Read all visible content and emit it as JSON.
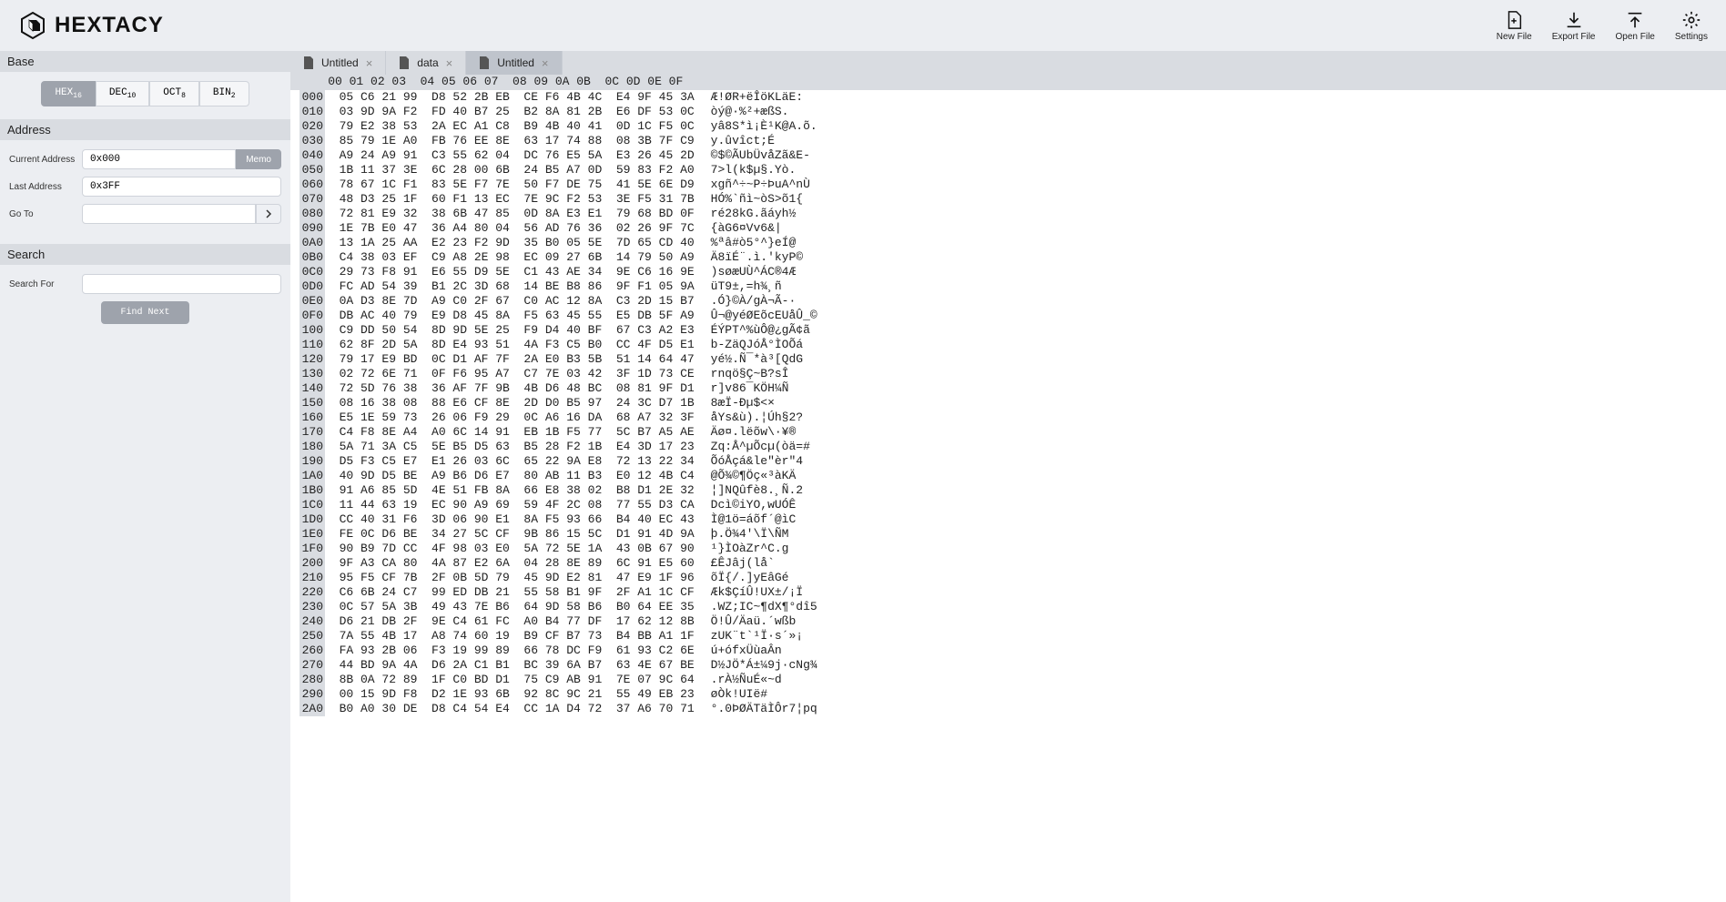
{
  "app": {
    "name": "HEXTACY"
  },
  "toolbar": {
    "new_file": "New File",
    "export_file": "Export File",
    "open_file": "Open File",
    "settings": "Settings"
  },
  "sidebar": {
    "base": {
      "title": "Base",
      "options": [
        {
          "label": "HEX",
          "sub": "16",
          "active": true
        },
        {
          "label": "DEC",
          "sub": "10",
          "active": false
        },
        {
          "label": "OCT",
          "sub": "8",
          "active": false
        },
        {
          "label": "BIN",
          "sub": "2",
          "active": false
        }
      ]
    },
    "address": {
      "title": "Address",
      "current_label": "Current Address",
      "current_value": "0x000",
      "memo_label": "Memo",
      "last_label": "Last Address",
      "last_value": "0x3FF",
      "goto_label": "Go To",
      "goto_value": ""
    },
    "search": {
      "title": "Search",
      "for_label": "Search For",
      "for_value": "",
      "find_label": "Find Next"
    }
  },
  "tabs": [
    {
      "title": "Untitled",
      "active": false
    },
    {
      "title": "data",
      "active": false
    },
    {
      "title": "Untitled",
      "active": true
    }
  ],
  "hex": {
    "col_header": "    00 01 02 03  04 05 06 07  08 09 0A 0B  0C 0D 0E 0F",
    "rows": [
      {
        "off": "000",
        "g": [
          "05 C6 21 99",
          "D8 52 2B EB",
          "CE F6 4B 4C",
          "E4 9F 45 3A"
        ],
        "a": "Æ!ØR+ëÎöKLäE:"
      },
      {
        "off": "010",
        "g": [
          "03 9D 9A F2",
          "FD 40 B7 25",
          "B2 8A 81 2B",
          "E6 DF 53 0C"
        ],
        "a": "òý@·%²+æßS."
      },
      {
        "off": "020",
        "g": [
          "79 E2 38 53",
          "2A EC A1 C8",
          "B9 4B 40 41",
          "0D 1C F5 0C"
        ],
        "a": "yâ8S*ì¡È¹K@A.õ."
      },
      {
        "off": "030",
        "g": [
          "85 79 1E A0",
          "FB 76 EE 8E",
          "63 17 74 88",
          "08 3B 7F C9"
        ],
        "a": "y.ûvîct;É"
      },
      {
        "off": "040",
        "g": [
          "A9 24 A9 91",
          "C3 55 62 04",
          "DC 76 E5 5A",
          "E3 26 45 2D"
        ],
        "a": "©$©ÃUbÜvåZã&E-"
      },
      {
        "off": "050",
        "g": [
          "1B 11 37 3E",
          "6C 28 00 6B",
          "24 B5 A7 0D",
          "59 83 F2 A0"
        ],
        "a": "7>l(k$µ§.Yò."
      },
      {
        "off": "060",
        "g": [
          "78 67 1C F1",
          "83 5E F7 7E",
          "50 F7 DE 75",
          "41 5E 6E D9"
        ],
        "a": "xgñ^÷~P÷ÞuA^nÙ"
      },
      {
        "off": "070",
        "g": [
          "48 D3 25 1F",
          "60 F1 13 EC",
          "7E 9C F2 53",
          "3E F5 31 7B"
        ],
        "a": "HÓ%`ñì~òS>õ1{"
      },
      {
        "off": "080",
        "g": [
          "72 81 E9 32",
          "38 6B 47 85",
          "0D 8A E3 E1",
          "79 68 BD 0F"
        ],
        "a": "ré28kG.ãáyh½"
      },
      {
        "off": "090",
        "g": [
          "1E 7B E0 47",
          "36 A4 80 04",
          "56 AD 76 36",
          "02 26 9F 7C"
        ],
        "a": "{àG6¤Vv6&|"
      },
      {
        "off": "0A0",
        "g": [
          "13 1A 25 AA",
          "E2 23 F2 9D",
          "35 B0 05 5E",
          "7D 65 CD 40"
        ],
        "a": "%ªâ#ò5°^}eÍ@"
      },
      {
        "off": "0B0",
        "g": [
          "C4 38 03 EF",
          "C9 A8 2E 98",
          "EC 09 27 6B",
          "14 79 50 A9"
        ],
        "a": "Ä8ïÉ¨.ì.'kyP©"
      },
      {
        "off": "0C0",
        "g": [
          "29 73 F8 91",
          "E6 55 D9 5E",
          "C1 43 AE 34",
          "9E C6 16 9E"
        ],
        "a": ")søæUÙ^ÁC®4Æ"
      },
      {
        "off": "0D0",
        "g": [
          "FC AD 54 39",
          "B1 2C 3D 68",
          "14 BE B8 86",
          "9F F1 05 9A"
        ],
        "a": "üT9±,=h¾¸ñ"
      },
      {
        "off": "0E0",
        "g": [
          "0A D3 8E 7D",
          "A9 C0 2F 67",
          "C0 AC 12 8A",
          "C3 2D 15 B7"
        ],
        "a": ".Ó}©À/gÀ¬Ã-·"
      },
      {
        "off": "0F0",
        "g": [
          "DB AC 40 79",
          "E9 D8 45 8A",
          "F5 63 45 55",
          "E5 DB 5F A9"
        ],
        "a": "Û¬@yéØEõcEUåÛ_©"
      },
      {
        "off": "100",
        "g": [
          "C9 DD 50 54",
          "8D 9D 5E 25",
          "F9 D4 40 BF",
          "67 C3 A2 E3"
        ],
        "a": "ÉÝPT^%ùÔ@¿gÃ¢ã"
      },
      {
        "off": "110",
        "g": [
          "62 8F 2D 5A",
          "8D E4 93 51",
          "4A F3 C5 B0",
          "CC 4F D5 E1"
        ],
        "a": "b-ZäQJóÅ°ÌOÕá"
      },
      {
        "off": "120",
        "g": [
          "79 17 E9 BD",
          "0C D1 AF 7F",
          "2A E0 B3 5B",
          "51 14 64 47"
        ],
        "a": "yé½.Ñ¯*à³[QdG"
      },
      {
        "off": "130",
        "g": [
          "02 72 6E 71",
          "0F F6 95 A7",
          "C7 7E 03 42",
          "3F 1D 73 CE"
        ],
        "a": "rnqö§Ç~B?sÎ"
      },
      {
        "off": "140",
        "g": [
          "72 5D 76 38",
          "36 AF 7F 9B",
          "4B D6 48 BC",
          "08 81 9F D1"
        ],
        "a": "r]v86¯KÖH¼Ñ"
      },
      {
        "off": "150",
        "g": [
          "08 16 38 08",
          "88 E6 CF 8E",
          "2D D0 B5 97",
          "24 3C D7 1B"
        ],
        "a": "8æÏ-Ðµ$<×"
      },
      {
        "off": "160",
        "g": [
          "E5 1E 59 73",
          "26 06 F9 29",
          "0C A6 16 DA",
          "68 A7 32 3F"
        ],
        "a": "åYs&ù).¦Úh§2?"
      },
      {
        "off": "170",
        "g": [
          "C4 F8 8E A4",
          "A0 6C 14 91",
          "EB 1B F5 77",
          "5C B7 A5 AE"
        ],
        "a": "Äø¤.lëõw\\·¥®"
      },
      {
        "off": "180",
        "g": [
          "5A 71 3A C5",
          "5E B5 D5 63",
          "B5 28 F2 1B",
          "E4 3D 17 23"
        ],
        "a": "Zq:Å^µÕcµ(òä=#"
      },
      {
        "off": "190",
        "g": [
          "D5 F3 C5 E7",
          "E1 26 03 6C",
          "65 22 9A E8",
          "72 13 22 34"
        ],
        "a": "ÕóÅçá&le\"èr\"4"
      },
      {
        "off": "1A0",
        "g": [
          "40 9D D5 BE",
          "A9 B6 D6 E7",
          "80 AB 11 B3",
          "E0 12 4B C4"
        ],
        "a": "@Õ¾©¶Öç«³àKÄ"
      },
      {
        "off": "1B0",
        "g": [
          "91 A6 85 5D",
          "4E 51 FB 8A",
          "66 E8 38 02",
          "B8 D1 2E 32"
        ],
        "a": "¦]NQûfè8.¸Ñ.2"
      },
      {
        "off": "1C0",
        "g": [
          "11 44 63 19",
          "EC 90 A9 69",
          "59 4F 2C 08",
          "77 55 D3 CA"
        ],
        "a": "Dcì©iYO,wUÓÊ"
      },
      {
        "off": "1D0",
        "g": [
          "CC 40 31 F6",
          "3D 06 90 E1",
          "8A F5 93 66",
          "B4 40 EC 43"
        ],
        "a": "Ì@1ö=áõf´@ìC"
      },
      {
        "off": "1E0",
        "g": [
          "FE 0C D6 BE",
          "34 27 5C CF",
          "9B 86 15 5C",
          "D1 91 4D 9A"
        ],
        "a": "þ.Ö¾4'\\Ï\\ÑM"
      },
      {
        "off": "1F0",
        "g": [
          "90 B9 7D CC",
          "4F 98 03 E0",
          "5A 72 5E 1A",
          "43 0B 67 90"
        ],
        "a": "¹}ÌOàZr^C.g"
      },
      {
        "off": "200",
        "g": [
          "9F A3 CA 80",
          "4A 87 E2 6A",
          "04 28 8E 89",
          "6C 91 E5 60"
        ],
        "a": "£ÊJâj(lå`"
      },
      {
        "off": "210",
        "g": [
          "95 F5 CF 7B",
          "2F 0B 5D 79",
          "45 9D E2 81",
          "47 E9 1F 96"
        ],
        "a": "õÏ{/.]yEâGé"
      },
      {
        "off": "220",
        "g": [
          "C6 6B 24 C7",
          "99 ED DB 21",
          "55 58 B1 9F",
          "2F A1 1C CF"
        ],
        "a": "Æk$ÇíÛ!UX±/¡Ï"
      },
      {
        "off": "230",
        "g": [
          "0C 57 5A 3B",
          "49 43 7E B6",
          "64 9D 58 B6",
          "B0 64 EE 35"
        ],
        "a": ".WZ;IC~¶dX¶°dî5"
      },
      {
        "off": "240",
        "g": [
          "D6 21 DB 2F",
          "9E C4 61 FC",
          "A0 B4 77 DF",
          "17 62 12 8B"
        ],
        "a": "Ö!Û/Äaü.´wßb"
      },
      {
        "off": "250",
        "g": [
          "7A 55 4B 17",
          "A8 74 60 19",
          "B9 CF B7 73",
          "B4 BB A1 1F"
        ],
        "a": "zUK¨t`¹Ï·s´»¡"
      },
      {
        "off": "260",
        "g": [
          "FA 93 2B 06",
          "F3 19 99 89",
          "66 78 DC F9",
          "61 93 C2 6E"
        ],
        "a": "ú+ófxÜùaÂn"
      },
      {
        "off": "270",
        "g": [
          "44 BD 9A 4A",
          "D6 2A C1 B1",
          "BC 39 6A B7",
          "63 4E 67 BE"
        ],
        "a": "D½JÖ*Á±¼9j·cNg¾"
      },
      {
        "off": "280",
        "g": [
          "8B 0A 72 89",
          "1F C0 BD D1",
          "75 C9 AB 91",
          "7E 07 9C 64"
        ],
        "a": ".rÀ½ÑuÉ«~d"
      },
      {
        "off": "290",
        "g": [
          "00 15 9D F8",
          "D2 1E 93 6B",
          "92 8C 9C 21",
          "55 49 EB 23"
        ],
        "a": "øÒk!UIë#"
      },
      {
        "off": "2A0",
        "g": [
          "B0 A0 30 DE",
          "D8 C4 54 E4",
          "CC 1A D4 72",
          "37 A6 70 71"
        ],
        "a": "°.0ÞØÄTäÌÔr7¦pq"
      }
    ]
  }
}
